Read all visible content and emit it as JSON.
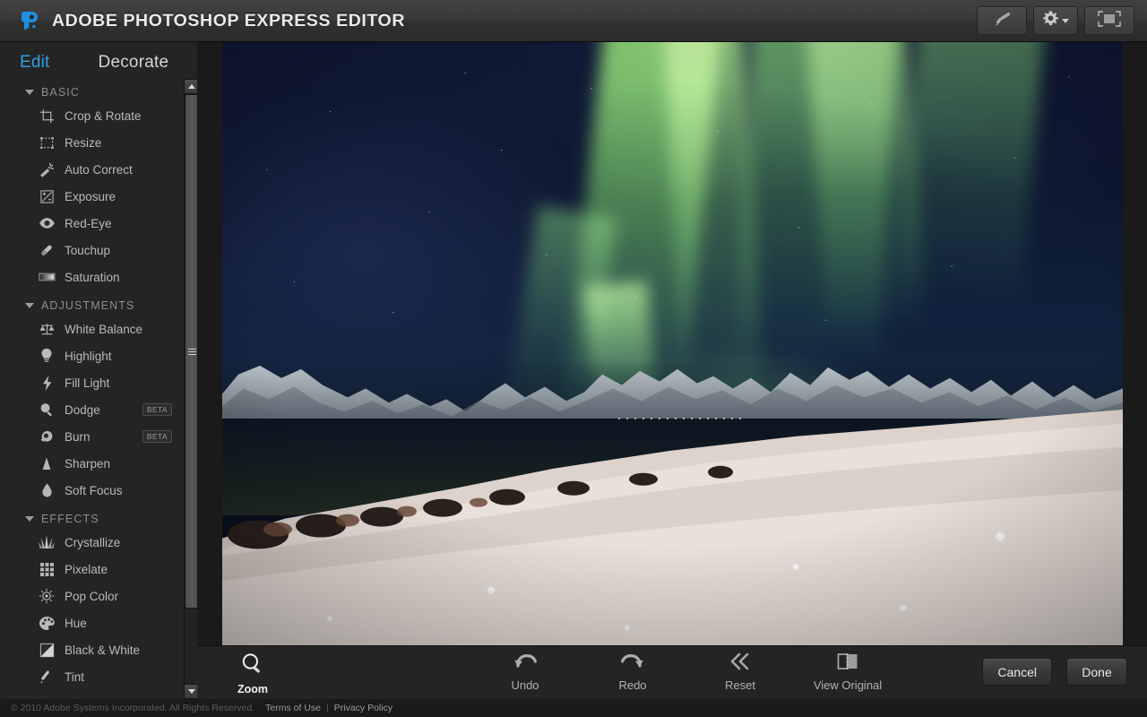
{
  "header": {
    "logo_icon": "photoshop-express-logo",
    "title": "ADOBE PHOTOSHOP EXPRESS EDITOR",
    "tools": [
      {
        "name": "feedback-button",
        "icon": "megaphone-icon",
        "label": ""
      },
      {
        "name": "settings-button",
        "icon": "gear-icon",
        "label": ""
      },
      {
        "name": "fullscreen-button",
        "icon": "expand-icon",
        "label": ""
      }
    ]
  },
  "tabs": [
    {
      "label": "Edit",
      "active": true
    },
    {
      "label": "Decorate",
      "active": false
    }
  ],
  "sidebar": {
    "groups": [
      {
        "title": "BASIC",
        "expanded": true,
        "items": [
          {
            "label": "Crop & Rotate",
            "icon": "crop-icon",
            "badge": ""
          },
          {
            "label": "Resize",
            "icon": "resize-icon",
            "badge": ""
          },
          {
            "label": "Auto Correct",
            "icon": "magic-wand-icon",
            "badge": ""
          },
          {
            "label": "Exposure",
            "icon": "exposure-icon",
            "badge": ""
          },
          {
            "label": "Red-Eye",
            "icon": "eye-icon",
            "badge": ""
          },
          {
            "label": "Touchup",
            "icon": "bandage-icon",
            "badge": ""
          },
          {
            "label": "Saturation",
            "icon": "saturation-gradient-icon",
            "badge": ""
          }
        ]
      },
      {
        "title": "ADJUSTMENTS",
        "expanded": true,
        "items": [
          {
            "label": "White Balance",
            "icon": "scales-icon",
            "badge": ""
          },
          {
            "label": "Highlight",
            "icon": "lightbulb-icon",
            "badge": ""
          },
          {
            "label": "Fill Light",
            "icon": "lightning-bolt-icon",
            "badge": ""
          },
          {
            "label": "Dodge",
            "icon": "dodge-magnifier-icon",
            "badge": "BETA"
          },
          {
            "label": "Burn",
            "icon": "burn-hand-icon",
            "badge": "BETA"
          },
          {
            "label": "Sharpen",
            "icon": "sharpen-triangle-icon",
            "badge": ""
          },
          {
            "label": "Soft Focus",
            "icon": "droplet-icon",
            "badge": ""
          }
        ]
      },
      {
        "title": "EFFECTS",
        "expanded": true,
        "items": [
          {
            "label": "Crystallize",
            "icon": "crystal-icon",
            "badge": ""
          },
          {
            "label": "Pixelate",
            "icon": "pixel-grid-icon",
            "badge": ""
          },
          {
            "label": "Pop Color",
            "icon": "target-icon",
            "badge": ""
          },
          {
            "label": "Hue",
            "icon": "palette-icon",
            "badge": ""
          },
          {
            "label": "Black & White",
            "icon": "half-tone-square-icon",
            "badge": ""
          },
          {
            "label": "Tint",
            "icon": "eyedropper-icon",
            "badge": ""
          }
        ]
      }
    ],
    "scrollbar": {
      "up_icon": "scroll-up-arrow-icon",
      "down_icon": "scroll-down-arrow-icon",
      "grip_icon": "scrollbar-grip-icon"
    }
  },
  "canvas": {
    "image_alt": "Aurora borealis over snowy fjord mountains and shoreline"
  },
  "bottombar": {
    "zoom": {
      "label": "Zoom",
      "icon": "magnifier-icon"
    },
    "actions": [
      {
        "label": "Undo",
        "icon": "undo-arrow-icon"
      },
      {
        "label": "Redo",
        "icon": "redo-arrow-icon"
      },
      {
        "label": "Reset",
        "icon": "double-chevron-left-icon"
      },
      {
        "label": "View Original",
        "icon": "split-view-icon"
      }
    ],
    "cancel_label": "Cancel",
    "done_label": "Done"
  },
  "footer": {
    "copyright": "© 2010 Adobe Systems Incorporated. All Rights Reserved.",
    "terms_label": "Terms of Use",
    "separator": "|",
    "privacy_label": "Privacy Policy"
  },
  "colors": {
    "accent_blue": "#2f9ee6",
    "panel_bg": "#242424",
    "header_bg": "#3a3a3a",
    "canvas_bg": "#1a1a1a",
    "text_primary": "#eaeaea",
    "text_muted": "#8e8e8e"
  }
}
